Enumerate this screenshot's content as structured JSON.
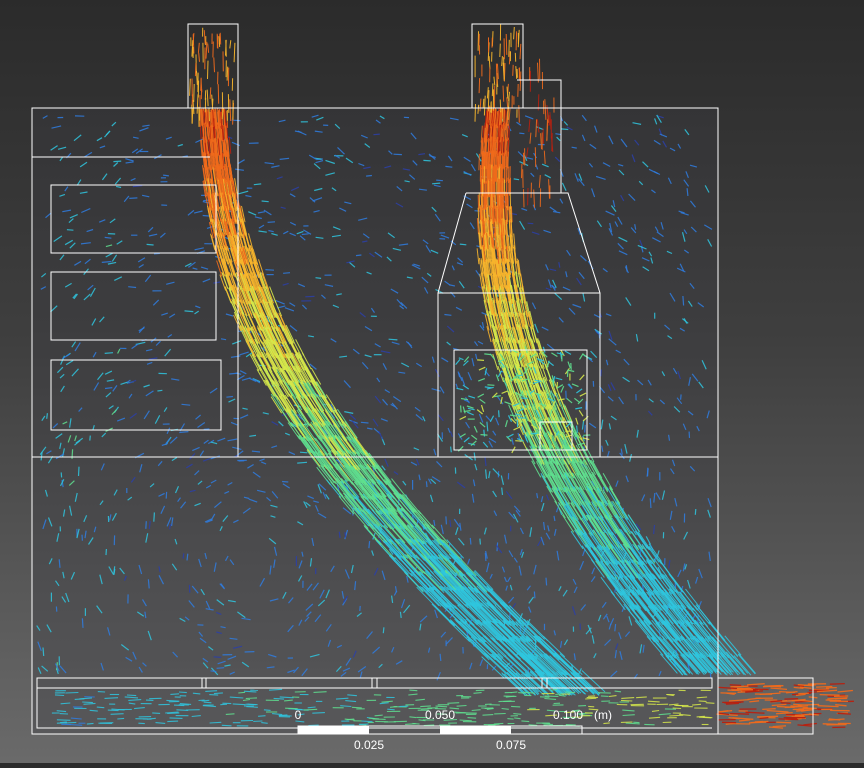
{
  "scale_bar": {
    "top_labels": [
      "0",
      "0.050",
      "0.100"
    ],
    "unit": "(m)",
    "bottom_labels": [
      "0.025",
      "0.075"
    ]
  },
  "colors": {
    "background_top": "#2b2b2b",
    "background_bottom": "#6a6a6a",
    "outline": "#ffffff",
    "colormap": [
      "#2b3fa8",
      "#2f7de0",
      "#2fc6df",
      "#5fe08f",
      "#d6e84a",
      "#f7b52c",
      "#ef6a1c",
      "#b8200f"
    ]
  },
  "legend_visible": false
}
